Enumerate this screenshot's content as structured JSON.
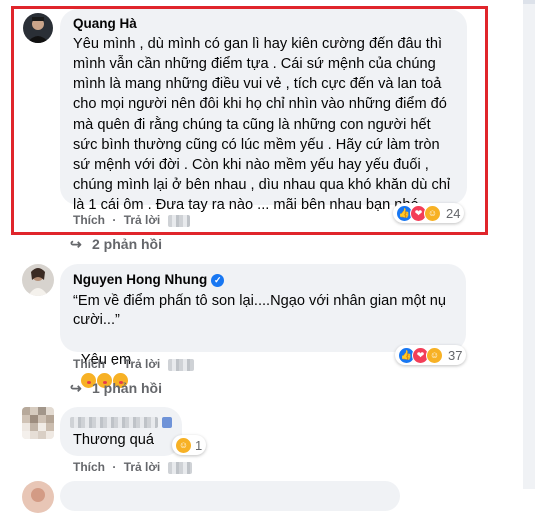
{
  "comments": [
    {
      "author": "Quang Hà",
      "lines": [
        "Yêu mình , dù mình có gan lì hay kiên cường đến đâu thì",
        "mình vẫn cần những điểm tựa . Cái sứ mệnh của chúng",
        "mình là mang những điều vui vẻ , tích cực đến và lan toả",
        "cho mọi người nên đôi khi họ chỉ nhìn vào những điểm đó",
        "mà quên đi rằng chúng ta cũng là những con người hết",
        "sức bình thường cũng có lúc mềm yếu . Hãy cứ làm tròn",
        "sứ mệnh với đời . Còn khi nào mềm yếu hay yếu đuối ,",
        "chúng mình lại ở bên nhau , dìu nhau qua khó khăn dù chỉ",
        "là 1 cái ôm . Đưa tay ra nào ... mãi bên nhau bạn nhé ."
      ],
      "like_label": "Thích",
      "reply_label": "Trả lời",
      "reaction_icons": [
        "like-icon",
        "love-icon",
        "care-icon"
      ],
      "reaction_count": "24",
      "replies_label": "2 phản hồi"
    },
    {
      "author": "Nguyen Hong Nhung",
      "verified": true,
      "lines": [
        "“Em về điểm phấn tô son lại....Ngạo với nhân gian một nụ",
        "cười...”",
        "Yêu em"
      ],
      "inline_emojis": [
        "kiss-emoji",
        "kiss-emoji",
        "kiss-emoji"
      ],
      "like_label": "Thích",
      "reply_label": "Trả lời",
      "reaction_icons": [
        "like-icon",
        "love-icon",
        "haha-icon"
      ],
      "reaction_count": "37",
      "replies_label": "1 phản hồi"
    },
    {
      "author_redacted": true,
      "lines": [
        "Thương quá"
      ],
      "like_label": "Thích",
      "reply_label": "Trả lời",
      "reaction_icons": [
        "care-icon"
      ],
      "reaction_count": "1"
    }
  ],
  "colors": {
    "highlight_border": "#e0252b",
    "bubble": "#f0f2f5",
    "secondary_text": "#65676b",
    "like_blue": "#1877f2",
    "love_red": "#f33e58",
    "haha_yellow": "#f7b125"
  }
}
